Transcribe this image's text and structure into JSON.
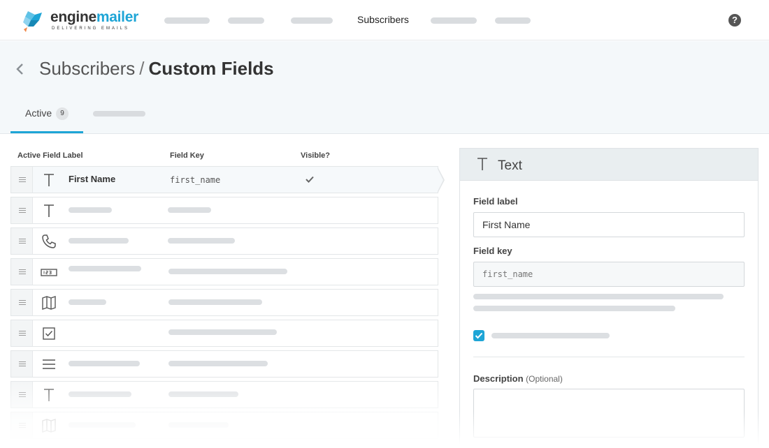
{
  "app": {
    "logo_main": "engine",
    "logo_accent": "mailer",
    "logo_tagline": "DELIVERING EMAILS",
    "brand_color": "#1ea5d6"
  },
  "nav": {
    "active_item": "Subscribers",
    "help_icon": "question-circle-icon"
  },
  "page": {
    "breadcrumb_parent": "Subscribers",
    "breadcrumb_separator": "/",
    "breadcrumb_current": "Custom Fields"
  },
  "tabs": {
    "active_label": "Active",
    "active_count": "9"
  },
  "table": {
    "headers": {
      "label": "Active Field Label",
      "key": "Field Key",
      "visible": "Visible?"
    },
    "rows": [
      {
        "icon": "text-icon",
        "label": "First Name",
        "key": "first_name",
        "visible": true
      },
      {
        "icon": "text-icon"
      },
      {
        "icon": "phone-icon"
      },
      {
        "icon": "number-icon"
      },
      {
        "icon": "map-icon"
      },
      {
        "icon": "checkbox-icon"
      },
      {
        "icon": "list-icon"
      },
      {
        "icon": "text-icon"
      },
      {
        "icon": "map-icon"
      }
    ]
  },
  "panel": {
    "type_label": "Text",
    "type_icon": "text-icon",
    "field_label_title": "Field label",
    "field_label_value": "First Name",
    "field_key_title": "Field key",
    "field_key_placeholder": "first_name",
    "visible_checked": true,
    "description_title": "Description",
    "description_optional": "(Optional)"
  }
}
